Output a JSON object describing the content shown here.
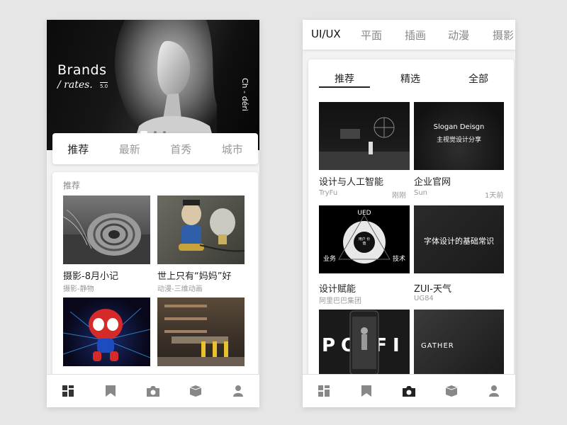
{
  "left": {
    "hero": {
      "brand": "Brands",
      "tagline": "/ rates.",
      "version": "5.0",
      "side_text": "Ch - déri"
    },
    "tabs": [
      {
        "label": "推荐",
        "active": true
      },
      {
        "label": "最新",
        "active": false
      },
      {
        "label": "首秀",
        "active": false
      },
      {
        "label": "城市",
        "active": false
      }
    ],
    "section_label": "推荐",
    "items": [
      {
        "title": "摄影-8月小记",
        "subtitle": "摄影-静物"
      },
      {
        "title": "世上只有“妈妈”好",
        "subtitle": "动漫-三维动画"
      },
      {
        "title": "",
        "subtitle": ""
      },
      {
        "title": "",
        "subtitle": ""
      }
    ]
  },
  "right": {
    "categories": [
      {
        "label": "UI/UX",
        "active": true
      },
      {
        "label": "平面",
        "active": false
      },
      {
        "label": "插画",
        "active": false
      },
      {
        "label": "动漫",
        "active": false
      },
      {
        "label": "摄影",
        "active": false
      }
    ],
    "sub_tabs": [
      {
        "label": "推荐",
        "active": true
      },
      {
        "label": "精选",
        "active": false
      },
      {
        "label": "全部",
        "active": false
      }
    ],
    "items": [
      {
        "title": "设计与人工智能",
        "author": "TryFu",
        "time": "刚刚"
      },
      {
        "title": "企业官网",
        "author": "Sun",
        "time": "1天前",
        "thumb_text": "Slogan Deisgn",
        "thumb_sub": "主视觉设计分享"
      },
      {
        "title": "设计赋能",
        "author": "阿里巴巴集团",
        "time": "",
        "thumb_top": "UED",
        "thumb_center": "用户 价值",
        "thumb_left": "业务",
        "thumb_right": "技术"
      },
      {
        "title": "ZUI-天气",
        "author": "UG84",
        "time": "",
        "thumb_text": "字体设计的基础常识"
      },
      {
        "title": "",
        "author": "",
        "time": "",
        "thumb_text": "PO FI"
      },
      {
        "title": "",
        "author": "",
        "time": "",
        "thumb_text": "GATHER"
      }
    ]
  },
  "nav_icons": [
    "grid-icon",
    "bookmark-icon",
    "camera-icon",
    "box-icon",
    "user-icon"
  ],
  "colors": {
    "active_text": "#222222",
    "inactive_text": "#999999",
    "nav_icon": "#888888",
    "nav_active": "#333333"
  }
}
